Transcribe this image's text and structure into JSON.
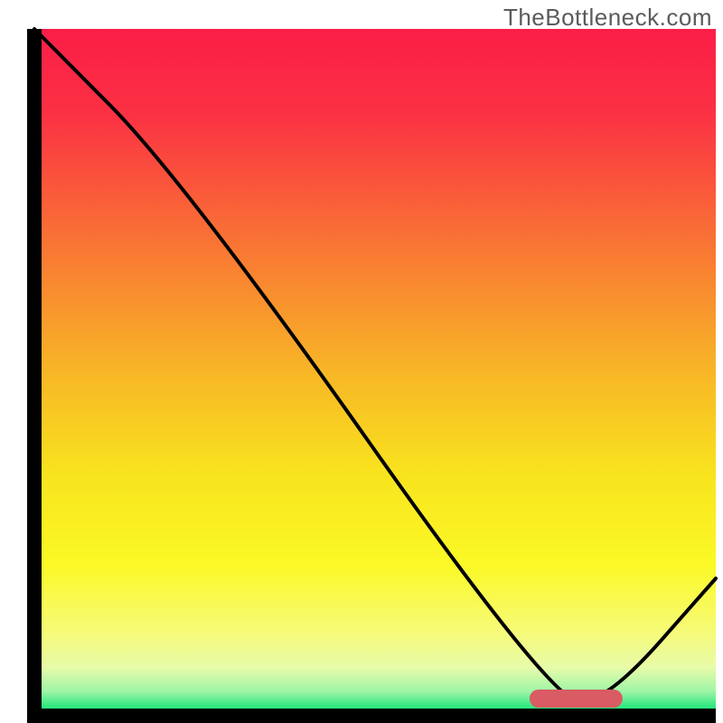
{
  "watermark": "TheBottleneck.com",
  "chart_data": {
    "type": "line",
    "title": "",
    "xlabel": "",
    "ylabel": "",
    "xlim": [
      0,
      100
    ],
    "ylim": [
      0,
      100
    ],
    "grid": false,
    "series": [
      {
        "name": "curve",
        "x": [
          0,
          22,
          76,
          84,
          100
        ],
        "values": [
          100,
          78,
          2,
          2,
          20
        ]
      }
    ],
    "marker": {
      "name": "optimal-range",
      "x_start": 74,
      "x_end": 85,
      "y": 2.5,
      "color": "#d95b63"
    },
    "gradient_stops": [
      {
        "offset": 0,
        "color": "#fb1e47"
      },
      {
        "offset": 0.12,
        "color": "#fb3044"
      },
      {
        "offset": 0.3,
        "color": "#f97035"
      },
      {
        "offset": 0.5,
        "color": "#f8b626"
      },
      {
        "offset": 0.65,
        "color": "#f8e41e"
      },
      {
        "offset": 0.78,
        "color": "#fbf926"
      },
      {
        "offset": 0.88,
        "color": "#f6fb7a"
      },
      {
        "offset": 0.93,
        "color": "#e7fba9"
      },
      {
        "offset": 0.965,
        "color": "#9df5a6"
      },
      {
        "offset": 0.985,
        "color": "#35e983"
      },
      {
        "offset": 1.0,
        "color": "#0fe277"
      }
    ]
  }
}
